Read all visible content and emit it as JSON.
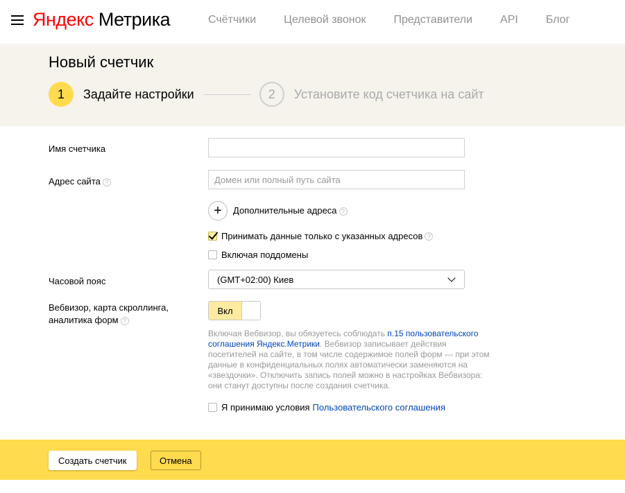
{
  "header": {
    "logo_brand": "Яндекс",
    "logo_product": "Метрика",
    "nav": [
      "Счётчики",
      "Целевой звонок",
      "Представители",
      "API",
      "Блог"
    ]
  },
  "page": {
    "title": "Новый счетчик",
    "steps": [
      {
        "number": "1",
        "label": "Задайте настройки",
        "active": true
      },
      {
        "number": "2",
        "label": "Установите код счетчика на сайт",
        "active": false
      }
    ]
  },
  "form": {
    "counter_name": {
      "label": "Имя счетчика",
      "value": ""
    },
    "site_address": {
      "label": "Адрес сайта",
      "placeholder": "Домен или полный путь сайта",
      "value": ""
    },
    "additional_addresses": {
      "icon": "+",
      "label": "Дополнительные адреса"
    },
    "only_specified_addresses": {
      "label": "Принимать данные только с указанных адресов",
      "checked": true
    },
    "include_subdomains": {
      "label": "Включая поддомены",
      "checked": false
    },
    "timezone": {
      "label": "Часовой пояс",
      "value": "(GMT+02:00) Киев"
    },
    "webvisor": {
      "label_line1": "Вебвизор, карта скроллинга,",
      "label_line2": "аналитика форм",
      "toggle_label": "Вкл",
      "enabled": true
    },
    "webvisor_note": {
      "text_before": "Включая Вебвизор, вы обязуетесь соблюдать ",
      "link": "п.15 пользовательского соглашения Яндекс.Метрики",
      "text_after": ". Вебвизор записывает действия посетителей на сайте, в том числе содержимое полей форм — при этом данные в конфиденциальных полях автоматически заменяются на «звездочки». Отключить запись полей можно в настройках Вебвизора: они станут доступны после создания счетчика."
    },
    "agreement": {
      "label": "Я принимаю условия",
      "link": "Пользовательского соглашения",
      "checked": false
    },
    "help_icon": "?"
  },
  "footer": {
    "create_label": "Создать счетчик",
    "cancel_label": "Отмена"
  },
  "colors": {
    "accent_yellow": "#ffdb4d",
    "logo_red": "#ff0000",
    "link_blue": "#0044bb",
    "hero_bg": "#f5f3ec"
  }
}
